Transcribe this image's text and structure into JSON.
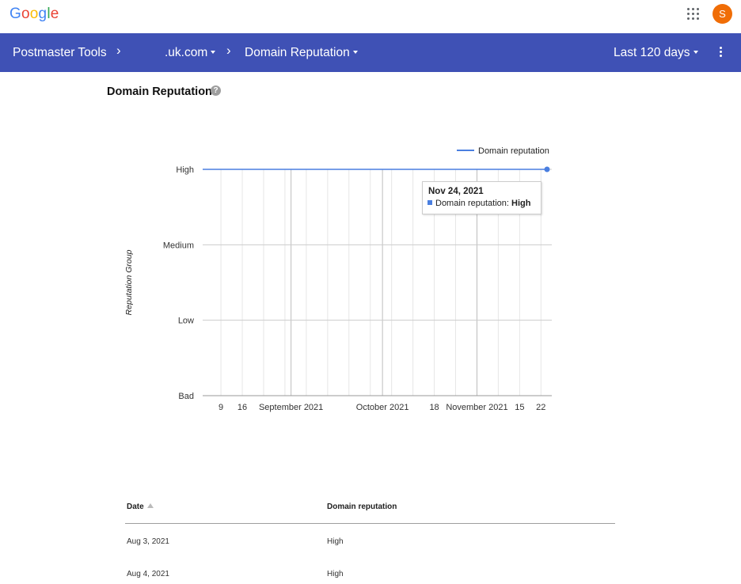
{
  "brand": {
    "logo_letters": [
      "G",
      "o",
      "o",
      "g",
      "l",
      "e"
    ],
    "logo_colors": [
      "#4285F4",
      "#EA4335",
      "#FBBC05",
      "#4285F4",
      "#34A853",
      "#EA4335"
    ]
  },
  "header": {
    "avatar_initial": "S",
    "apps_icon": "apps-grid-icon"
  },
  "nav": {
    "app_title": "Postmaster Tools",
    "domain": ".uk.com",
    "section": "Domain Reputation",
    "range": "Last 120 days",
    "bg_color": "#3f51b5"
  },
  "page": {
    "title": "Domain Reputation",
    "help": "?"
  },
  "chart_data": {
    "type": "line",
    "ylabel": "Reputation Group",
    "y_categories": [
      "Bad",
      "Low",
      "Medium",
      "High"
    ],
    "x_tick_labels": [
      "9",
      "16",
      "September 2021",
      "October 2021",
      "18",
      "November 2021",
      "15",
      "22"
    ],
    "x_range": [
      "2021-08-03",
      "2021-11-24"
    ],
    "series": [
      {
        "name": "Domain reputation",
        "color": "#4a7fe0",
        "points": [
          {
            "x": "2021-08-03",
            "y": "High"
          },
          {
            "x": "2021-11-24",
            "y": "High"
          }
        ]
      }
    ],
    "legend_position": "top-right",
    "grid": true,
    "tooltip": {
      "date": "Nov 24, 2021",
      "label": "Domain reputation:",
      "value": "High"
    }
  },
  "table": {
    "headers": {
      "date": "Date",
      "reputation": "Domain reputation"
    },
    "rows": [
      {
        "date": "Aug 3, 2021",
        "reputation": "High"
      },
      {
        "date": "Aug 4, 2021",
        "reputation": "High"
      }
    ]
  }
}
